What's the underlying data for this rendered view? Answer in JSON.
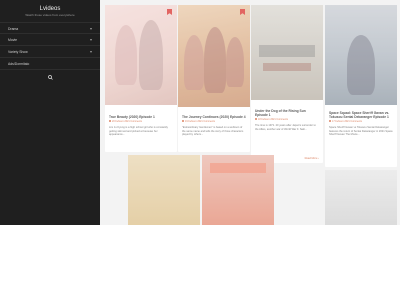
{
  "sidebar": {
    "title": "Lvideos",
    "tagline": "Watch those videos from everywhere",
    "items": [
      {
        "label": "Drama",
        "has_children": true
      },
      {
        "label": "Movie",
        "has_children": true
      },
      {
        "label": "Variety Show",
        "has_children": true
      },
      {
        "label": "Ads/Dormitaio",
        "has_children": false
      }
    ],
    "search_icon": "search-icon"
  },
  "cards": [
    {
      "title": "True Beauty (2020) Episode 1",
      "meta": "20 Febrero 2021 Comments",
      "excerpt": "Lim Ju Kyung is a high school girl who is constantly getting skinned and picked at because her appearance...",
      "bookmark": true
    },
    {
      "title": "The Journey Continues (2020) Episode 4",
      "meta": "19 Febrero 2021 Comments",
      "excerpt": "\"Extraordinary Gentlemen\" is based on a webtoon of the same name and tells the story of three characters played by others...",
      "bookmark": true
    },
    {
      "title": "Under the Dog of the Rising Sun Episode 1",
      "meta": "18 Febrero 2021 Comments",
      "excerpt": "The time is 1971. 20 years after Japan's surrender to the Allies, another war of World War II. Saki...",
      "readmore": "Read More ›"
    },
    {
      "title": "Space Squad: Space Sheriff Gavan vs. Tokusou Sentai Dekaranger Episode 1",
      "meta": "17 Febrero 2021 Comments",
      "excerpt": "Space Sheriff Gavan vs Tokusou Sentai Dekaranger features the return of Sentai Dekaranger in 2021 Space Sheriff Gavan The Movie..."
    }
  ],
  "colors": {
    "sidebar_bg": "#1f1f1f",
    "accent": "#d05a2e",
    "bookmark": "#d8322e"
  }
}
